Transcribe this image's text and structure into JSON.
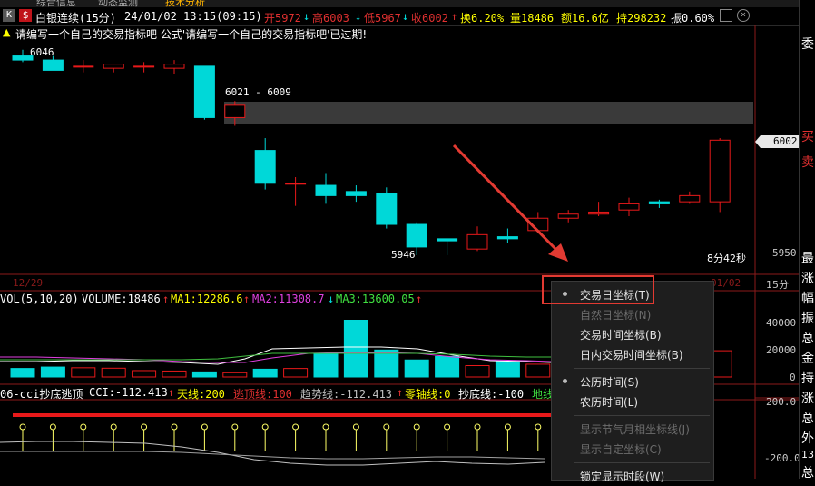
{
  "top_tabs": [
    "综合信息",
    "动态监测",
    "技术分析"
  ],
  "info": {
    "flag": "K",
    "dollar": "$",
    "name": "白银连续(15分)",
    "datetime": "24/01/02 13:15(09:15)",
    "open_label": "开5972",
    "high_arrow": "↓",
    "high_label": "高6003",
    "low_arrow": "↓",
    "low_label": "低5967",
    "close_arrow": "↓",
    "close_label": "收6002",
    "turnover_arrow": "↑",
    "turnover_label": "换6.20%",
    "volume_label": "量18486",
    "amount_label": "额16.6亿",
    "hold_label": "持298232",
    "amp_label": "振0.60%",
    "icon1": "settings-icon",
    "icon2": "close-icon"
  },
  "warning": {
    "icon": "triangle-icon",
    "text": "请编写一个自己的交易指标吧   公式'请编写一个自己的交易指标吧'已过期!"
  },
  "price_labels": {
    "high": "6046",
    "range": "6021 - 6009",
    "low": "5946",
    "current": "6002",
    "axis_low": "5950",
    "countdown": "8分42秒"
  },
  "date_axis": {
    "left": "12/29",
    "right": "01/02",
    "period": "15分"
  },
  "vol_legend": {
    "name": "VOL(5,10,20)",
    "volume": "VOLUME:18486",
    "ma1_arrow": "↑",
    "ma1": "MA1:12286.6",
    "ma2_arrow": "↑",
    "ma2": "MA2:11308.7",
    "ma3_arrow": "↓",
    "ma3": "MA3:13600.05",
    "end_arrow": "↑"
  },
  "vol_axis": [
    "40000",
    "20000",
    "0"
  ],
  "cci_legend": {
    "name": "06-cci抄底逃顶",
    "cci": "CCI:-112.413",
    "cci_arrow": "↑",
    "tianxian": "天线:200",
    "taoding": "逃顶线:100",
    "qushi": "趋势线:-112.413",
    "qushi_arrow": "↑",
    "zero": "零轴线:0",
    "chaodi": "抄底线:-100",
    "dixian": "地线"
  },
  "cci_axis": [
    "200.0",
    "-200.0"
  ],
  "right_panel": [
    "委",
    "买",
    "卖",
    "最",
    "涨",
    "幅",
    "振",
    "总",
    "金",
    "持",
    "涨",
    "总",
    "外",
    "13",
    "总"
  ],
  "context_menu": {
    "items": [
      {
        "label": "交易日坐标(T)",
        "checked": true,
        "disabled": false
      },
      {
        "label": "自然日坐标(N)",
        "checked": false,
        "disabled": true
      },
      {
        "label": "交易时间坐标(B)",
        "checked": false,
        "disabled": false
      },
      {
        "label": "日内交易时间坐标(B)",
        "checked": false,
        "disabled": false
      },
      {
        "label": "公历时间(S)",
        "checked": true,
        "disabled": false
      },
      {
        "label": "农历时间(L)",
        "checked": false,
        "disabled": false
      },
      {
        "label": "显示节气月相坐标线(J)",
        "checked": false,
        "disabled": true
      },
      {
        "label": "显示自定坐标(C)",
        "checked": false,
        "disabled": true
      },
      {
        "label": "锁定显示时段(W)",
        "checked": false,
        "disabled": false
      }
    ]
  },
  "chart_data": {
    "type": "candlestick",
    "period": "15分",
    "candles": [
      {
        "o": 6043,
        "h": 6046,
        "l": 6040,
        "c": 6041
      },
      {
        "o": 6041,
        "h": 6043,
        "l": 6036,
        "c": 6036
      },
      {
        "o": 6038,
        "h": 6041,
        "l": 6035,
        "c": 6038
      },
      {
        "o": 6037,
        "h": 6039,
        "l": 6035,
        "c": 6039
      },
      {
        "o": 6038,
        "h": 6040,
        "l": 6035,
        "c": 6038
      },
      {
        "o": 6037,
        "h": 6041,
        "l": 6034,
        "c": 6039
      },
      {
        "o": 6038,
        "h": 6038,
        "l": 6012,
        "c": 6013
      },
      {
        "o": 6013,
        "h": 6021,
        "l": 6009,
        "c": 6019
      },
      {
        "o": 5997,
        "h": 6003,
        "l": 5978,
        "c": 5981
      },
      {
        "o": 5981,
        "h": 5984,
        "l": 5970,
        "c": 5981
      },
      {
        "o": 5980,
        "h": 5986,
        "l": 5971,
        "c": 5975
      },
      {
        "o": 5977,
        "h": 5980,
        "l": 5972,
        "c": 5975
      },
      {
        "o": 5976,
        "h": 5979,
        "l": 5959,
        "c": 5961
      },
      {
        "o": 5961,
        "h": 5962,
        "l": 5946,
        "c": 5950
      },
      {
        "o": 5954,
        "h": 5954,
        "l": 5946,
        "c": 5953
      },
      {
        "o": 5949,
        "h": 5960,
        "l": 5948,
        "c": 5956
      },
      {
        "o": 5955,
        "h": 5959,
        "l": 5952,
        "c": 5954
      },
      {
        "o": 5958,
        "h": 5967,
        "l": 5957,
        "c": 5964
      },
      {
        "o": 5964,
        "h": 5968,
        "l": 5962,
        "c": 5966
      },
      {
        "o": 5966,
        "h": 5972,
        "l": 5965,
        "c": 5967
      },
      {
        "o": 5968,
        "h": 5974,
        "l": 5965,
        "c": 5971
      },
      {
        "o": 5972,
        "h": 5973,
        "l": 5969,
        "c": 5971
      },
      {
        "o": 5972,
        "h": 5977,
        "l": 5971,
        "c": 5975
      },
      {
        "o": 5972,
        "h": 6003,
        "l": 5967,
        "c": 6002
      }
    ],
    "volume": [
      6000,
      7000,
      6500,
      6200,
      4500,
      4200,
      3600,
      3000,
      5500,
      6000,
      16000,
      40000,
      19000,
      12000,
      14500,
      8000,
      11000,
      9000,
      14500,
      8000,
      5500,
      9500,
      10000,
      18486
    ],
    "vol_ylim": [
      0,
      48000
    ],
    "price_ylim": [
      5942,
      6049
    ]
  }
}
